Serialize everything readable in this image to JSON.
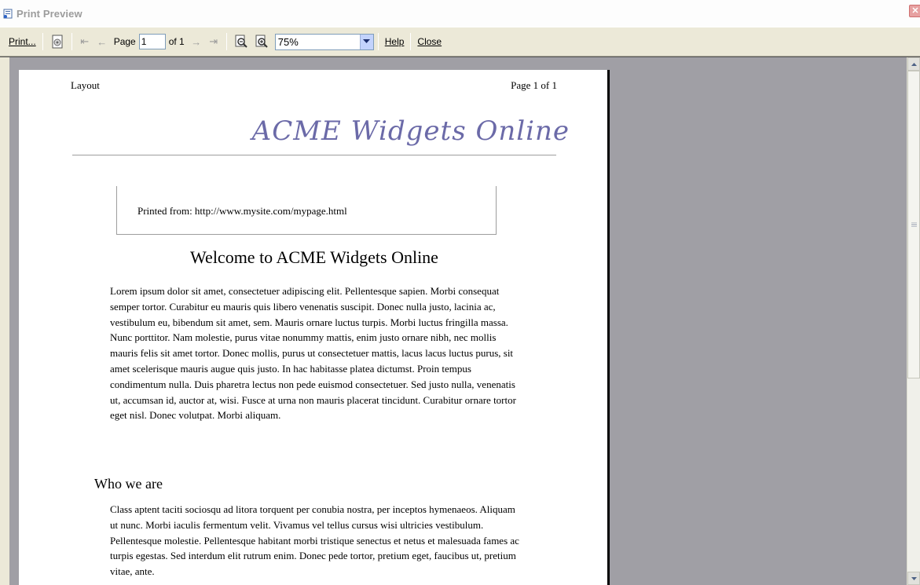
{
  "window": {
    "title": "Print Preview",
    "close_glyph": "✕"
  },
  "toolbar": {
    "print_label": "Print...",
    "page_label": "Page",
    "page_value": "1",
    "of_label": "of 1",
    "zoom_value": "75%",
    "help_label": "Help",
    "close_label": "Close"
  },
  "page": {
    "header_left": "Layout",
    "header_right": "Page 1 of 1",
    "brand": "ACME Widgets Online",
    "printed_from": "Printed from: http://www.mysite.com/mypage.html",
    "heading": "Welcome to ACME Widgets Online",
    "paragraph1": "Lorem ipsum dolor sit amet, consectetuer adipiscing elit. Pellentesque sapien. Morbi consequat semper tortor. Curabitur eu mauris quis libero venenatis suscipit. Donec nulla justo, lacinia ac, vestibulum eu, bibendum sit amet, sem. Mauris ornare luctus turpis. Morbi luctus fringilla massa. Nunc porttitor. Nam molestie, purus vitae nonummy mattis, enim justo ornare nibh, nec mollis mauris felis sit amet tortor. Donec mollis, purus ut consectetuer mattis, lacus lacus luctus purus, sit amet scelerisque mauris augue quis justo. In hac habitasse platea dictumst. Proin tempus condimentum nulla. Duis pharetra lectus non pede euismod consectetuer. Sed justo nulla, venenatis ut, accumsan id, auctor at, wisi. Fusce at urna non mauris placerat tincidunt. Curabitur ornare tortor eget nisl. Donec volutpat. Morbi aliquam.",
    "subheading": "Who we are",
    "paragraph2": "Class aptent taciti sociosqu ad litora torquent per conubia nostra, per inceptos hymenaeos. Aliquam ut nunc. Morbi iaculis fermentum velit. Vivamus vel tellus cursus wisi ultricies vestibulum. Pellentesque molestie. Pellentesque habitant morbi tristique senectus et netus et malesuada fames ac turpis egestas. Sed interdum elit rutrum enim. Donec pede tortor, pretium eget, faucibus ut, pretium vitae, ante."
  },
  "icons": {
    "app": "page-icon",
    "page_setup": "page-setup-icon",
    "first": "first-page-icon",
    "prev": "previous-page-icon",
    "next": "next-page-icon",
    "last": "last-page-icon",
    "zoom_out": "zoom-out-icon",
    "zoom_in": "zoom-in-icon",
    "dropdown": "chevron-down-icon"
  },
  "colors": {
    "brand": "#6b6aa8",
    "workspace": "#a09fa5",
    "toolbar": "#ece9d8"
  }
}
